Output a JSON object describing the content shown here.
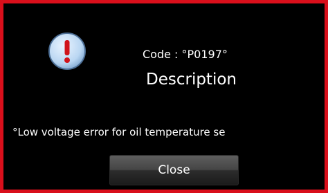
{
  "dialog": {
    "border_color": "#d90f1b",
    "background_color": "#000000",
    "icon": "exclamation-alert-icon",
    "code_line": "Code : °P0197°",
    "title": "Description",
    "message": "°Low voltage error for oil temperature se",
    "close_label": "Close"
  }
}
